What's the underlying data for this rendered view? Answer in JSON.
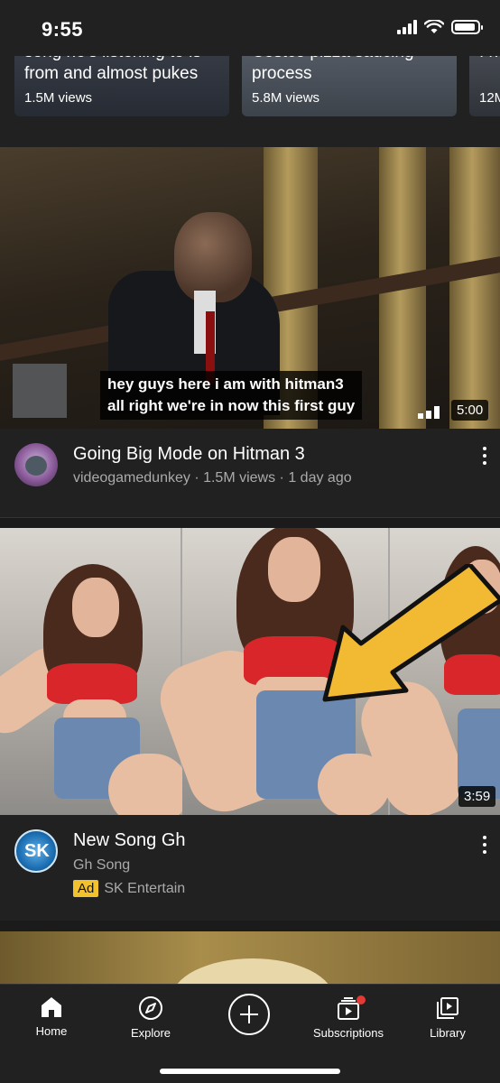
{
  "status_bar": {
    "time": "9:55",
    "battery_level": 0.9
  },
  "shorts": [
    {
      "title": "song he's listening to is\nfrom and almost pukes",
      "views": "1.5M views"
    },
    {
      "title": "Costco pizza saucing\nprocess",
      "views": "5.8M views"
    },
    {
      "title": "I n",
      "views": "12M"
    }
  ],
  "video1": {
    "subtitle": "hey guys here i am with hitman3\nall right we're in now this first guy",
    "duration": "5:00",
    "title": "Going Big Mode on Hitman 3",
    "meta": "videogamedunkey · 1.5M views · 1 day ago"
  },
  "video2": {
    "duration": "3:59",
    "title": "New Song Gh",
    "channel": "Gh Song",
    "ad_badge": "Ad",
    "advertiser": "SK Entertain",
    "avatar_text": "SK"
  },
  "nav": {
    "home": "Home",
    "explore": "Explore",
    "subscriptions": "Subscriptions",
    "library": "Library"
  },
  "colors": {
    "background": "#212121",
    "ad_badge": "#f2c12e",
    "notification": "#e53935",
    "arrow": "#f2b933"
  }
}
